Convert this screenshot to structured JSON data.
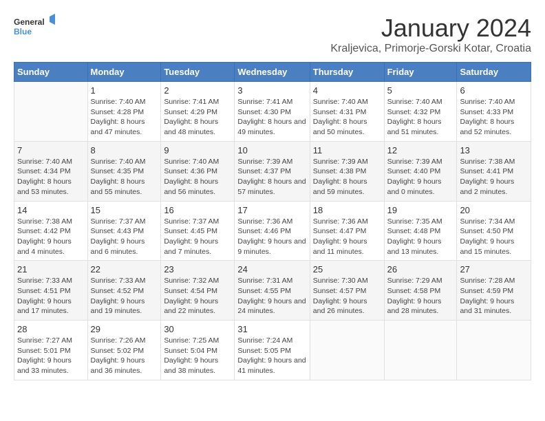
{
  "header": {
    "logo_general": "General",
    "logo_blue": "Blue",
    "title": "January 2024",
    "subtitle": "Kraljevica, Primorje-Gorski Kotar, Croatia"
  },
  "weekdays": [
    "Sunday",
    "Monday",
    "Tuesday",
    "Wednesday",
    "Thursday",
    "Friday",
    "Saturday"
  ],
  "weeks": [
    [
      {
        "day": "",
        "sunrise": "",
        "sunset": "",
        "daylight": ""
      },
      {
        "day": "1",
        "sunrise": "Sunrise: 7:40 AM",
        "sunset": "Sunset: 4:28 PM",
        "daylight": "Daylight: 8 hours and 47 minutes."
      },
      {
        "day": "2",
        "sunrise": "Sunrise: 7:41 AM",
        "sunset": "Sunset: 4:29 PM",
        "daylight": "Daylight: 8 hours and 48 minutes."
      },
      {
        "day": "3",
        "sunrise": "Sunrise: 7:41 AM",
        "sunset": "Sunset: 4:30 PM",
        "daylight": "Daylight: 8 hours and 49 minutes."
      },
      {
        "day": "4",
        "sunrise": "Sunrise: 7:40 AM",
        "sunset": "Sunset: 4:31 PM",
        "daylight": "Daylight: 8 hours and 50 minutes."
      },
      {
        "day": "5",
        "sunrise": "Sunrise: 7:40 AM",
        "sunset": "Sunset: 4:32 PM",
        "daylight": "Daylight: 8 hours and 51 minutes."
      },
      {
        "day": "6",
        "sunrise": "Sunrise: 7:40 AM",
        "sunset": "Sunset: 4:33 PM",
        "daylight": "Daylight: 8 hours and 52 minutes."
      }
    ],
    [
      {
        "day": "7",
        "sunrise": "Sunrise: 7:40 AM",
        "sunset": "Sunset: 4:34 PM",
        "daylight": "Daylight: 8 hours and 53 minutes."
      },
      {
        "day": "8",
        "sunrise": "Sunrise: 7:40 AM",
        "sunset": "Sunset: 4:35 PM",
        "daylight": "Daylight: 8 hours and 55 minutes."
      },
      {
        "day": "9",
        "sunrise": "Sunrise: 7:40 AM",
        "sunset": "Sunset: 4:36 PM",
        "daylight": "Daylight: 8 hours and 56 minutes."
      },
      {
        "day": "10",
        "sunrise": "Sunrise: 7:39 AM",
        "sunset": "Sunset: 4:37 PM",
        "daylight": "Daylight: 8 hours and 57 minutes."
      },
      {
        "day": "11",
        "sunrise": "Sunrise: 7:39 AM",
        "sunset": "Sunset: 4:38 PM",
        "daylight": "Daylight: 8 hours and 59 minutes."
      },
      {
        "day": "12",
        "sunrise": "Sunrise: 7:39 AM",
        "sunset": "Sunset: 4:40 PM",
        "daylight": "Daylight: 9 hours and 0 minutes."
      },
      {
        "day": "13",
        "sunrise": "Sunrise: 7:38 AM",
        "sunset": "Sunset: 4:41 PM",
        "daylight": "Daylight: 9 hours and 2 minutes."
      }
    ],
    [
      {
        "day": "14",
        "sunrise": "Sunrise: 7:38 AM",
        "sunset": "Sunset: 4:42 PM",
        "daylight": "Daylight: 9 hours and 4 minutes."
      },
      {
        "day": "15",
        "sunrise": "Sunrise: 7:37 AM",
        "sunset": "Sunset: 4:43 PM",
        "daylight": "Daylight: 9 hours and 6 minutes."
      },
      {
        "day": "16",
        "sunrise": "Sunrise: 7:37 AM",
        "sunset": "Sunset: 4:45 PM",
        "daylight": "Daylight: 9 hours and 7 minutes."
      },
      {
        "day": "17",
        "sunrise": "Sunrise: 7:36 AM",
        "sunset": "Sunset: 4:46 PM",
        "daylight": "Daylight: 9 hours and 9 minutes."
      },
      {
        "day": "18",
        "sunrise": "Sunrise: 7:36 AM",
        "sunset": "Sunset: 4:47 PM",
        "daylight": "Daylight: 9 hours and 11 minutes."
      },
      {
        "day": "19",
        "sunrise": "Sunrise: 7:35 AM",
        "sunset": "Sunset: 4:48 PM",
        "daylight": "Daylight: 9 hours and 13 minutes."
      },
      {
        "day": "20",
        "sunrise": "Sunrise: 7:34 AM",
        "sunset": "Sunset: 4:50 PM",
        "daylight": "Daylight: 9 hours and 15 minutes."
      }
    ],
    [
      {
        "day": "21",
        "sunrise": "Sunrise: 7:33 AM",
        "sunset": "Sunset: 4:51 PM",
        "daylight": "Daylight: 9 hours and 17 minutes."
      },
      {
        "day": "22",
        "sunrise": "Sunrise: 7:33 AM",
        "sunset": "Sunset: 4:52 PM",
        "daylight": "Daylight: 9 hours and 19 minutes."
      },
      {
        "day": "23",
        "sunrise": "Sunrise: 7:32 AM",
        "sunset": "Sunset: 4:54 PM",
        "daylight": "Daylight: 9 hours and 22 minutes."
      },
      {
        "day": "24",
        "sunrise": "Sunrise: 7:31 AM",
        "sunset": "Sunset: 4:55 PM",
        "daylight": "Daylight: 9 hours and 24 minutes."
      },
      {
        "day": "25",
        "sunrise": "Sunrise: 7:30 AM",
        "sunset": "Sunset: 4:57 PM",
        "daylight": "Daylight: 9 hours and 26 minutes."
      },
      {
        "day": "26",
        "sunrise": "Sunrise: 7:29 AM",
        "sunset": "Sunset: 4:58 PM",
        "daylight": "Daylight: 9 hours and 28 minutes."
      },
      {
        "day": "27",
        "sunrise": "Sunrise: 7:28 AM",
        "sunset": "Sunset: 4:59 PM",
        "daylight": "Daylight: 9 hours and 31 minutes."
      }
    ],
    [
      {
        "day": "28",
        "sunrise": "Sunrise: 7:27 AM",
        "sunset": "Sunset: 5:01 PM",
        "daylight": "Daylight: 9 hours and 33 minutes."
      },
      {
        "day": "29",
        "sunrise": "Sunrise: 7:26 AM",
        "sunset": "Sunset: 5:02 PM",
        "daylight": "Daylight: 9 hours and 36 minutes."
      },
      {
        "day": "30",
        "sunrise": "Sunrise: 7:25 AM",
        "sunset": "Sunset: 5:04 PM",
        "daylight": "Daylight: 9 hours and 38 minutes."
      },
      {
        "day": "31",
        "sunrise": "Sunrise: 7:24 AM",
        "sunset": "Sunset: 5:05 PM",
        "daylight": "Daylight: 9 hours and 41 minutes."
      },
      {
        "day": "",
        "sunrise": "",
        "sunset": "",
        "daylight": ""
      },
      {
        "day": "",
        "sunrise": "",
        "sunset": "",
        "daylight": ""
      },
      {
        "day": "",
        "sunrise": "",
        "sunset": "",
        "daylight": ""
      }
    ]
  ]
}
